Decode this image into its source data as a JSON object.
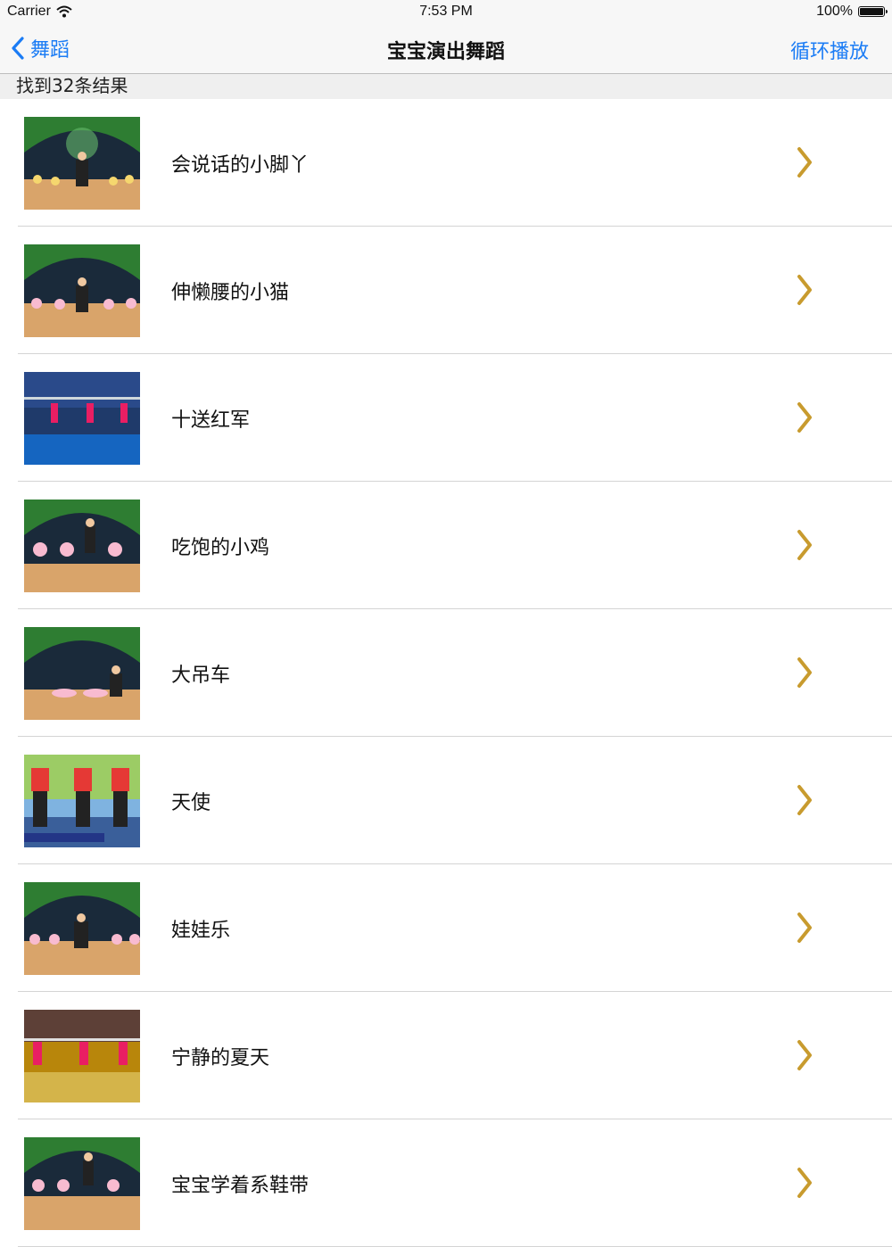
{
  "status_bar": {
    "carrier": "Carrier",
    "time": "7:53 PM",
    "battery": "100%"
  },
  "nav": {
    "back_label": "舞蹈",
    "title": "宝宝演出舞蹈",
    "right_button": "循环播放"
  },
  "results_text": "找到32条结果",
  "items": [
    {
      "title": "会说话的小脚丫",
      "thumb_icon": "stage-dance-thumbnail-icon"
    },
    {
      "title": "伸懒腰的小猫",
      "thumb_icon": "stage-dance-thumbnail-icon"
    },
    {
      "title": "十送红军",
      "thumb_icon": "studio-dance-thumbnail-icon"
    },
    {
      "title": "吃饱的小鸡",
      "thumb_icon": "stage-dance-thumbnail-icon"
    },
    {
      "title": "大吊车",
      "thumb_icon": "stage-dance-thumbnail-icon"
    },
    {
      "title": "天使",
      "thumb_icon": "adult-dance-thumbnail-icon"
    },
    {
      "title": "娃娃乐",
      "thumb_icon": "stage-dance-thumbnail-icon"
    },
    {
      "title": "宁静的夏天",
      "thumb_icon": "barre-dance-thumbnail-icon"
    },
    {
      "title": "宝宝学着系鞋带",
      "thumb_icon": "stage-dance-thumbnail-icon"
    }
  ],
  "colors": {
    "accent": "#1b7cf5",
    "chevron": "#c89b2e",
    "separator": "#d4d4d4"
  }
}
